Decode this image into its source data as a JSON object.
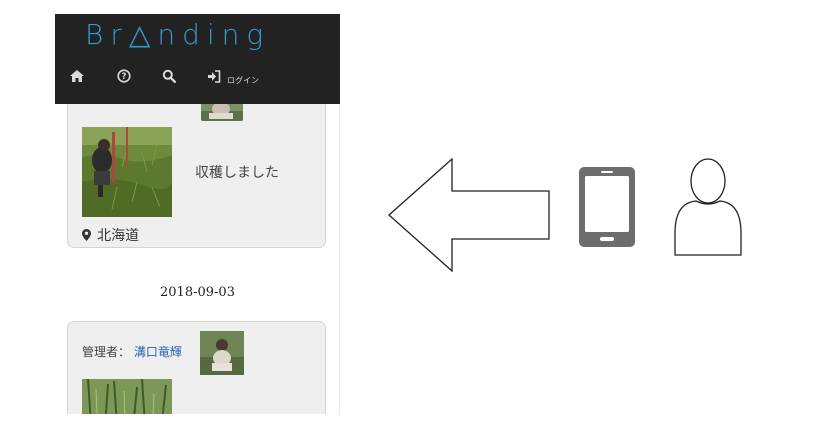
{
  "navbar": {
    "brand": "Br△nding",
    "login_label": "ログイン",
    "icons": [
      "home-icon",
      "help-icon",
      "search-icon",
      "login-icon"
    ]
  },
  "feed": {
    "post1": {
      "text": "収穫しました",
      "location": "北海道"
    },
    "date": "2018-09-03",
    "post2": {
      "admin_label": "管理者：",
      "admin_name": "溝口竜輝"
    }
  },
  "colors": {
    "navbar_bg": "#222222",
    "brand": "#2f9ccf",
    "card_bg": "#efefef",
    "link": "#2a65b0",
    "device": "#6d6d6d"
  }
}
